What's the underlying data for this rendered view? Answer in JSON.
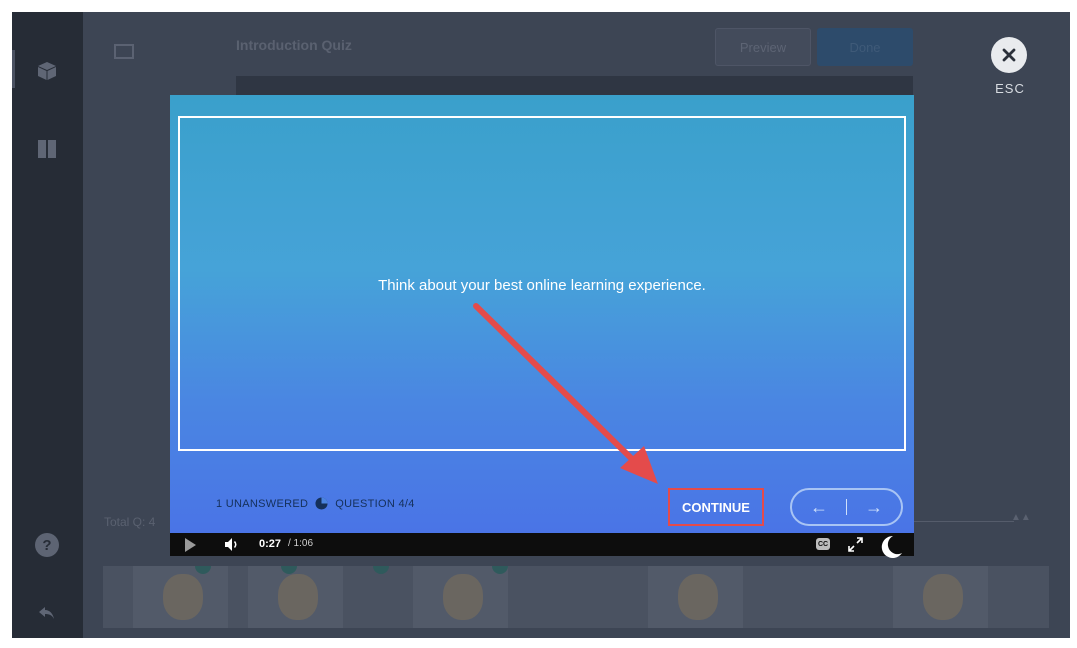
{
  "editor": {
    "title": "Introduction Quiz",
    "preview_label": "Preview",
    "done_label": "Done",
    "total_label": "Total Q: 4"
  },
  "close": {
    "esc_label": "ESC"
  },
  "slide": {
    "prompt": "Think about your best online learning experience.",
    "unanswered": "1 UNANSWERED",
    "question": "QUESTION 4/4",
    "continue_label": "CONTINUE",
    "prev_icon": "arrow-left-icon",
    "next_icon": "arrow-right-icon"
  },
  "player": {
    "current_time": "0:27",
    "total_time": "/ 1:06",
    "progress": 0.41
  },
  "colors": {
    "accent_red": "#e44b4b",
    "slide_top": "#3aa0cb",
    "slide_bottom": "#4a74e6"
  }
}
